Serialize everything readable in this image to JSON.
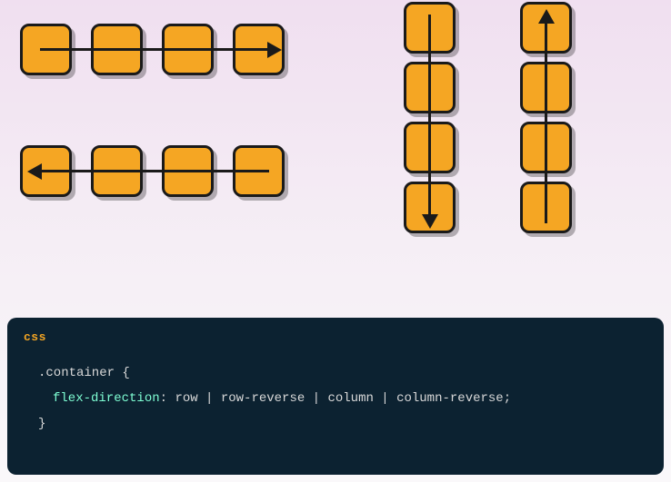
{
  "code": {
    "label": "css",
    "selector": ".container",
    "open_brace": "{",
    "property": "flex-direction",
    "colon": ":",
    "values": "row | row-reverse | column | column-reverse",
    "semicolon": ";",
    "close_brace": "}"
  },
  "diagram": {
    "row_boxes": 4,
    "row_reverse_boxes": 4,
    "column_boxes": 4,
    "column_reverse_boxes": 4
  },
  "colors": {
    "box_fill": "#f5a623",
    "box_border": "#1a1a1a",
    "code_bg": "#0c2231",
    "code_label": "#f5a623",
    "code_prop": "#7fffd4"
  }
}
